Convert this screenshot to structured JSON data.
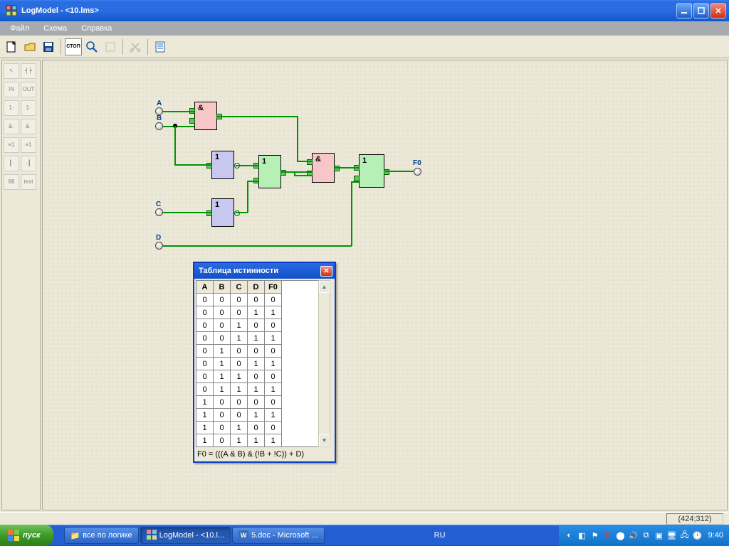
{
  "window": {
    "title": "LogModel - <10.lms>"
  },
  "menu": {
    "file": "Файл",
    "scheme": "Схема",
    "help": "Справка"
  },
  "palette": {
    "in": "IN",
    "out": "OUT",
    "buf1": "1·",
    "buf2": "1·",
    "and1": "&·",
    "and2": "&·",
    "nand1": "≡1",
    "nand2": "≡1",
    "mux1": "┃·",
    "mux2": "·┃",
    "seg": "88",
    "text": "text"
  },
  "io": {
    "A": "A",
    "B": "B",
    "C": "C",
    "D": "D",
    "F0": "F0"
  },
  "gates": {
    "and": "&",
    "not": "1",
    "or": "1"
  },
  "truth": {
    "title": "Таблица истинности",
    "headers": [
      "A",
      "B",
      "C",
      "D",
      "F0"
    ],
    "rows": [
      [
        "0",
        "0",
        "0",
        "0",
        "0"
      ],
      [
        "0",
        "0",
        "0",
        "1",
        "1"
      ],
      [
        "0",
        "0",
        "1",
        "0",
        "0"
      ],
      [
        "0",
        "0",
        "1",
        "1",
        "1"
      ],
      [
        "0",
        "1",
        "0",
        "0",
        "0"
      ],
      [
        "0",
        "1",
        "0",
        "1",
        "1"
      ],
      [
        "0",
        "1",
        "1",
        "0",
        "0"
      ],
      [
        "0",
        "1",
        "1",
        "1",
        "1"
      ],
      [
        "1",
        "0",
        "0",
        "0",
        "0"
      ],
      [
        "1",
        "0",
        "0",
        "1",
        "1"
      ],
      [
        "1",
        "0",
        "1",
        "0",
        "0"
      ],
      [
        "1",
        "0",
        "1",
        "1",
        "1"
      ]
    ],
    "formula": "F0 = (((A & B) & (!B + !C)) + D)"
  },
  "status": {
    "coord": "(424;312)"
  },
  "taskbar": {
    "start": "пуск",
    "task1": "все по логике",
    "task2": "LogModel - <10.l...",
    "task3": "5.doc - Microsoft ...",
    "lang": "RU",
    "clock": "9:40"
  }
}
